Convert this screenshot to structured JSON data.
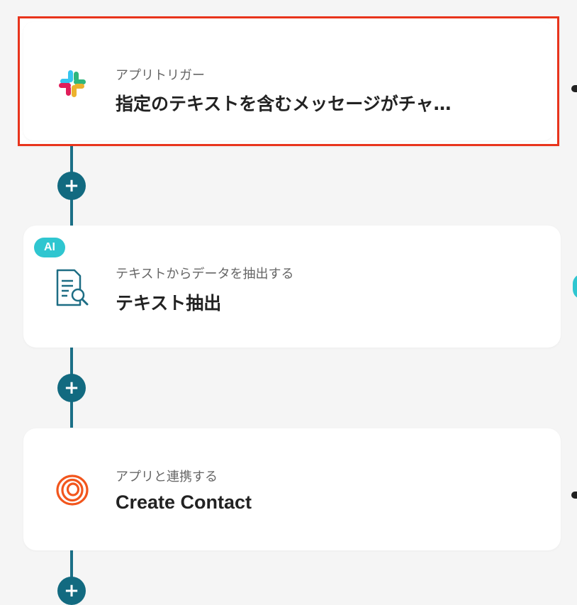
{
  "steps": [
    {
      "subtitle": "アプリトリガー",
      "title": "指定のテキストを含むメッセージがチャ…",
      "icon": "slack-icon",
      "selected": true
    },
    {
      "subtitle": "テキストからデータを抽出する",
      "title": "テキスト抽出",
      "icon": "document-search-icon",
      "badge": "AI"
    },
    {
      "subtitle": "アプリと連携する",
      "title": "Create Contact",
      "icon": "loop-icon"
    }
  ],
  "add_step_glyph": "+",
  "colors": {
    "connector": "#1b6f86",
    "selected_border": "#e8341c",
    "ai_badge": "#2fc6d0",
    "loop_orange": "#f2561d"
  }
}
